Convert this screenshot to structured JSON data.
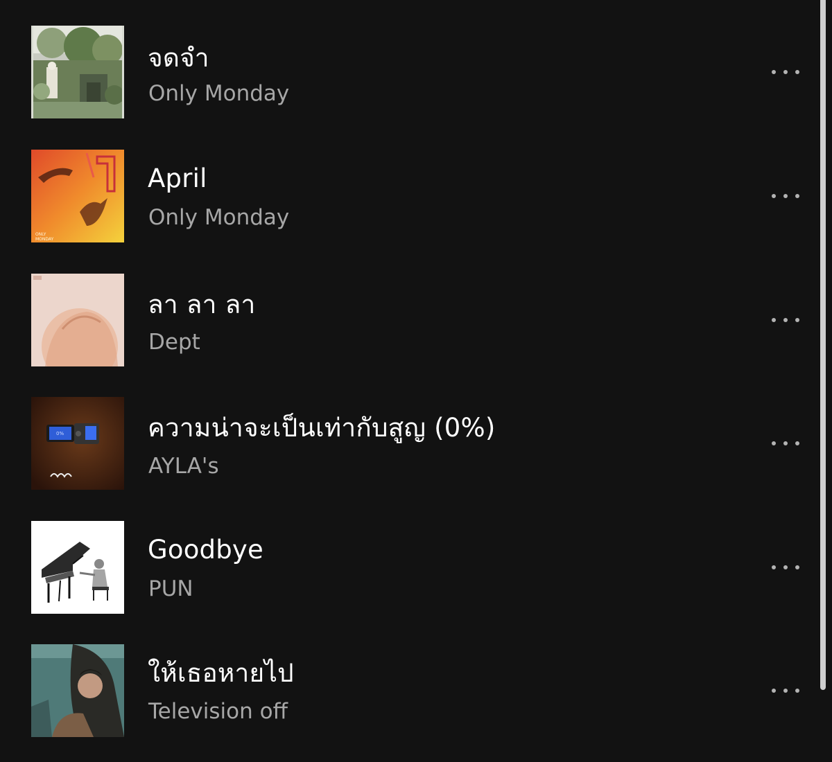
{
  "tracks": [
    {
      "title": "จดจำ",
      "artist": "Only Monday",
      "art": "overgrown-ruins-cover",
      "more_icon": "more-options-icon"
    },
    {
      "title": "April",
      "artist": "Only Monday",
      "art": "orange-hands-cover",
      "art_text": "ONLY MONDAY",
      "more_icon": "more-options-icon"
    },
    {
      "title": "ลา ลา ลา",
      "artist": "Dept",
      "art": "pale-portrait-cover",
      "more_icon": "more-options-icon"
    },
    {
      "title": "ความน่าจะเป็นเท่ากับสูญ (0%)",
      "artist": "AYLA's",
      "art": "camera-screen-cover",
      "more_icon": "more-options-icon"
    },
    {
      "title": "Goodbye",
      "artist": "PUN",
      "art": "piano-sketch-cover",
      "more_icon": "more-options-icon"
    },
    {
      "title": "ให้เธอหายไป",
      "artist": "Television off",
      "art": "teal-portrait-cover",
      "more_icon": "more-options-icon"
    }
  ],
  "colors": {
    "background": "#121212",
    "title": "#ffffff",
    "artist": "#a7a7a7",
    "icon": "#b3b3b3",
    "scrollbar": "#cfcfcf"
  }
}
